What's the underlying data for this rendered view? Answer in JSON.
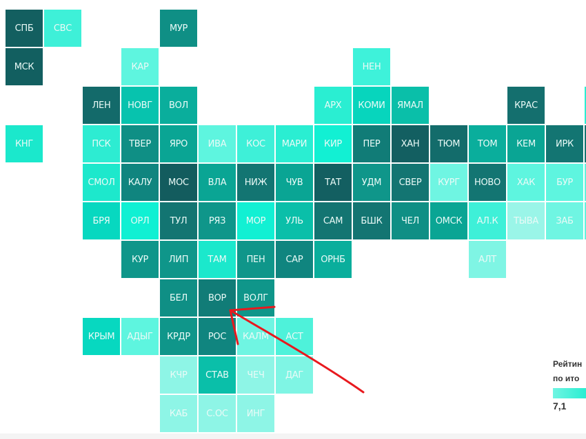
{
  "map": {
    "tiles": [
      {
        "label": "СПБ",
        "row": 0,
        "col": 0,
        "color": "#135f60"
      },
      {
        "label": "СВС",
        "row": 0,
        "col": 1,
        "color": "#3ef0d8"
      },
      {
        "label": "МУР",
        "row": 0,
        "col": 4,
        "color": "#0f8f85"
      },
      {
        "label": "МСК",
        "row": 1,
        "col": 0,
        "color": "#125f60"
      },
      {
        "label": "КАР",
        "row": 1,
        "col": 3,
        "color": "#5ef5df"
      },
      {
        "label": "НЕН",
        "row": 1,
        "col": 9,
        "color": "#3ef2da"
      },
      {
        "label": "ЛЕН",
        "row": 2,
        "col": 2,
        "color": "#136a6a"
      },
      {
        "label": "НОВГ",
        "row": 2,
        "col": 3,
        "color": "#07c3ae"
      },
      {
        "label": "ВОЛ",
        "row": 2,
        "col": 4,
        "color": "#0aae9c"
      },
      {
        "label": "АРХ",
        "row": 2,
        "col": 8,
        "color": "#2aeed2"
      },
      {
        "label": "КОМИ",
        "row": 2,
        "col": 9,
        "color": "#07d5bd"
      },
      {
        "label": "ЯМАЛ",
        "row": 2,
        "col": 10,
        "color": "#0abfa9"
      },
      {
        "label": "КРАС",
        "row": 2,
        "col": 13,
        "color": "#146f6e"
      },
      {
        "label": "КНГ",
        "row": 3,
        "col": 0,
        "color": "#1be8cc"
      },
      {
        "label": "ПСК",
        "row": 3,
        "col": 2,
        "color": "#2decd2"
      },
      {
        "label": "ТВЕР",
        "row": 3,
        "col": 3,
        "color": "#0f8f85"
      },
      {
        "label": "ЯРО",
        "row": 3,
        "col": 4,
        "color": "#0aa594"
      },
      {
        "label": "ИВА",
        "row": 3,
        "col": 5,
        "color": "#5ef5df"
      },
      {
        "label": "КОС",
        "row": 3,
        "col": 6,
        "color": "#3ef0d8"
      },
      {
        "label": "МАРИ",
        "row": 3,
        "col": 7,
        "color": "#2aeed2"
      },
      {
        "label": "КИР",
        "row": 3,
        "col": 8,
        "color": "#12f0d3"
      },
      {
        "label": "ПЕР",
        "row": 3,
        "col": 9,
        "color": "#117c77"
      },
      {
        "label": "ХАН",
        "row": 3,
        "col": 10,
        "color": "#135f61"
      },
      {
        "label": "ТЮМ",
        "row": 3,
        "col": 11,
        "color": "#136c6b"
      },
      {
        "label": "ТОМ",
        "row": 3,
        "col": 12,
        "color": "#0aae9c"
      },
      {
        "label": "КЕМ",
        "row": 3,
        "col": 13,
        "color": "#0aa594"
      },
      {
        "label": "ИРК",
        "row": 3,
        "col": 14,
        "color": "#137572"
      },
      {
        "label": "СМОЛ",
        "row": 4,
        "col": 2,
        "color": "#1de8cc"
      },
      {
        "label": "КАЛУ",
        "row": 4,
        "col": 3,
        "color": "#10857f"
      },
      {
        "label": "МОС",
        "row": 4,
        "col": 4,
        "color": "#135c5e"
      },
      {
        "label": "ВЛА",
        "row": 4,
        "col": 5,
        "color": "#0aa594"
      },
      {
        "label": "НИЖ",
        "row": 4,
        "col": 6,
        "color": "#137572"
      },
      {
        "label": "ЧУВ",
        "row": 4,
        "col": 7,
        "color": "#0aa594"
      },
      {
        "label": "ТАТ",
        "row": 4,
        "col": 8,
        "color": "#135f61"
      },
      {
        "label": "УДМ",
        "row": 4,
        "col": 9,
        "color": "#0f968a"
      },
      {
        "label": "СВЕР",
        "row": 4,
        "col": 10,
        "color": "#137572"
      },
      {
        "label": "КУРГ",
        "row": 4,
        "col": 11,
        "color": "#6ff5e2"
      },
      {
        "label": "НОВО",
        "row": 4,
        "col": 12,
        "color": "#137572"
      },
      {
        "label": "ХАК",
        "row": 4,
        "col": 13,
        "color": "#5ef5df"
      },
      {
        "label": "БУР",
        "row": 4,
        "col": 14,
        "color": "#5ef5df"
      },
      {
        "label": "БРЯ",
        "row": 5,
        "col": 2,
        "color": "#07d8c0"
      },
      {
        "label": "ОРЛ",
        "row": 5,
        "col": 3,
        "color": "#10f0d3"
      },
      {
        "label": "ТУЛ",
        "row": 5,
        "col": 4,
        "color": "#137572"
      },
      {
        "label": "РЯЗ",
        "row": 5,
        "col": 5,
        "color": "#0f968a"
      },
      {
        "label": "МОР",
        "row": 5,
        "col": 6,
        "color": "#12f0d3"
      },
      {
        "label": "УЛЬ",
        "row": 5,
        "col": 7,
        "color": "#0abfa9"
      },
      {
        "label": "САМ",
        "row": 5,
        "col": 8,
        "color": "#137572"
      },
      {
        "label": "БШК",
        "row": 5,
        "col": 9,
        "color": "#137572"
      },
      {
        "label": "ЧЕЛ",
        "row": 5,
        "col": 10,
        "color": "#0f8f85"
      },
      {
        "label": "ОМСК",
        "row": 5,
        "col": 11,
        "color": "#0aa594"
      },
      {
        "label": "АЛ.К",
        "row": 5,
        "col": 12,
        "color": "#3ef0d8"
      },
      {
        "label": "ТЫВА",
        "row": 5,
        "col": 13,
        "color": "#9af5e8"
      },
      {
        "label": "ЗАБ",
        "row": 5,
        "col": 14,
        "color": "#6ff5e2"
      },
      {
        "label": "КУР",
        "row": 6,
        "col": 3,
        "color": "#0f968a"
      },
      {
        "label": "ЛИП",
        "row": 6,
        "col": 4,
        "color": "#0f968a"
      },
      {
        "label": "ТАМ",
        "row": 6,
        "col": 5,
        "color": "#1be8cc"
      },
      {
        "label": "ПЕН",
        "row": 6,
        "col": 6,
        "color": "#0f968a"
      },
      {
        "label": "САР",
        "row": 6,
        "col": 7,
        "color": "#10857f"
      },
      {
        "label": "ОРНБ",
        "row": 6,
        "col": 8,
        "color": "#0aae9c"
      },
      {
        "label": "АЛТ",
        "row": 6,
        "col": 12,
        "color": "#7ff5e4"
      },
      {
        "label": "БЕЛ",
        "row": 7,
        "col": 4,
        "color": "#0f8f85"
      },
      {
        "label": "ВОР",
        "row": 7,
        "col": 5,
        "color": "#117c77"
      },
      {
        "label": "ВОЛГ",
        "row": 7,
        "col": 6,
        "color": "#0f968a"
      },
      {
        "label": "КРЫМ",
        "row": 8,
        "col": 2,
        "color": "#07d8c0"
      },
      {
        "label": "АДЫГ",
        "row": 8,
        "col": 3,
        "color": "#5ef5df"
      },
      {
        "label": "КРДР",
        "row": 8,
        "col": 4,
        "color": "#0f968a"
      },
      {
        "label": "РОС",
        "row": 8,
        "col": 5,
        "color": "#10857f"
      },
      {
        "label": "КАЛМ",
        "row": 8,
        "col": 6,
        "color": "#6ff5e2"
      },
      {
        "label": "АСТ",
        "row": 8,
        "col": 7,
        "color": "#4ef2da"
      },
      {
        "label": "КЧР",
        "row": 9,
        "col": 4,
        "color": "#8ef5e6"
      },
      {
        "label": "СТАВ",
        "row": 9,
        "col": 5,
        "color": "#0abfa9"
      },
      {
        "label": "ЧЕЧ",
        "row": 9,
        "col": 6,
        "color": "#8ef5e6"
      },
      {
        "label": "ДАГ",
        "row": 9,
        "col": 7,
        "color": "#7ff5e4"
      },
      {
        "label": "КАБ",
        "row": 10,
        "col": 4,
        "color": "#8ef5e6"
      },
      {
        "label": "С.ОС",
        "row": 10,
        "col": 5,
        "color": "#8ef5e6"
      },
      {
        "label": "ИНГ",
        "row": 10,
        "col": 6,
        "color": "#8ef5e6"
      }
    ],
    "edge_tiles": [
      {
        "row": 2,
        "col": 15,
        "color": "#2aeed2"
      },
      {
        "row": 3,
        "col": 15,
        "color": "#137572"
      },
      {
        "row": 4,
        "col": 15,
        "color": "#5ef5df"
      },
      {
        "row": 5,
        "col": 15,
        "color": "#5ef5df"
      }
    ]
  },
  "legend": {
    "title_line1": "Рейтин",
    "title_line2": "по ито",
    "min_value": "7,1",
    "gradient_colors": [
      "#6ff5e2",
      "#2aeed2"
    ]
  },
  "annotation": {
    "type": "red-arrow",
    "color": "#e8191e",
    "points_to": "ВОР"
  }
}
